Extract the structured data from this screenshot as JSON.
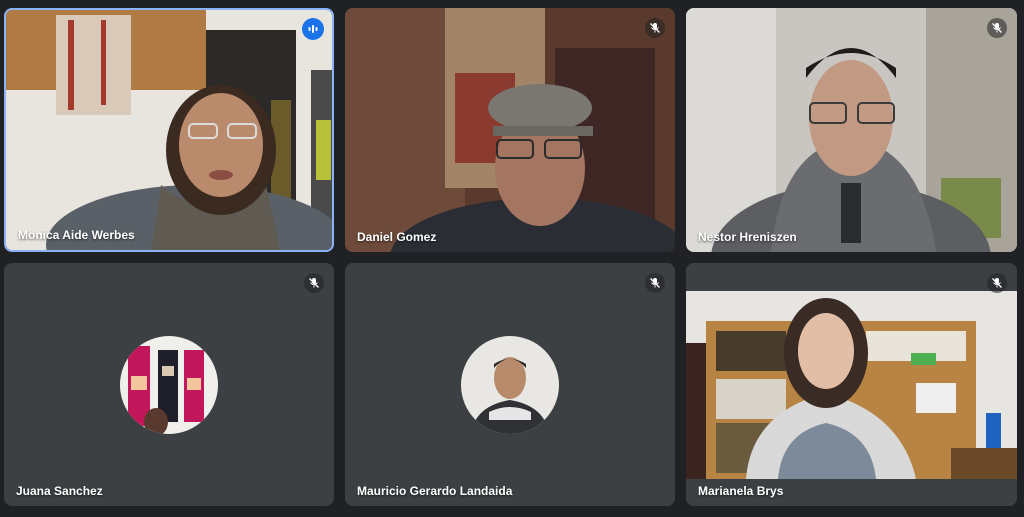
{
  "participants": [
    {
      "name": "Monica Aide Werbes",
      "state": "speaking"
    },
    {
      "name": "Daniel Gomez",
      "state": "muted"
    },
    {
      "name": "Nestor Hreniszen",
      "state": "muted"
    },
    {
      "name": "Juana Sanchez",
      "state": "muted"
    },
    {
      "name": "Mauricio Gerardo Landaida",
      "state": "muted"
    },
    {
      "name": "Marianela Brys",
      "state": "muted"
    }
  ],
  "icons": {
    "muted": "mic-off-icon",
    "speaking": "audio-level-icon"
  },
  "colors": {
    "background": "#202124",
    "tile": "#3c4043",
    "active_border": "#8ab4f8",
    "speaking_badge": "#1a73e8"
  }
}
